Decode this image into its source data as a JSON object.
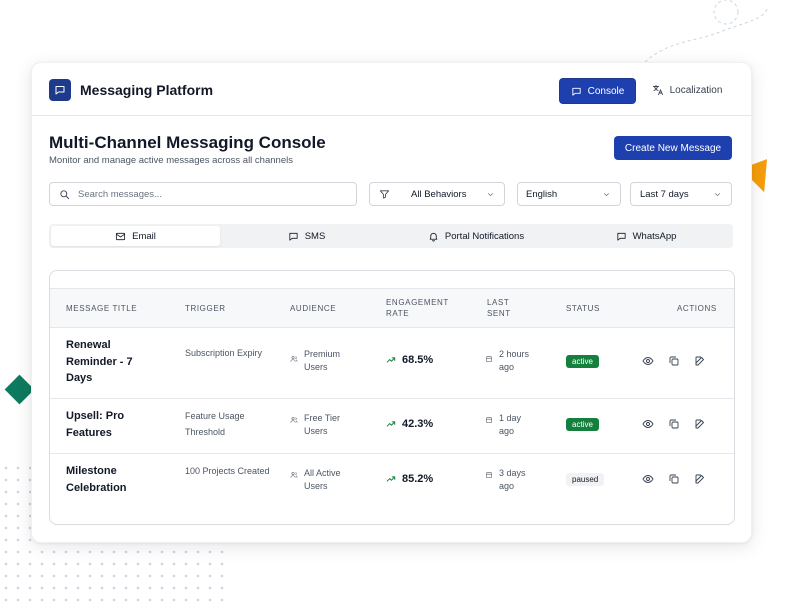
{
  "app": {
    "title": "Messaging Platform"
  },
  "nav": {
    "console_label": "Console",
    "localization_label": "Localization"
  },
  "header": {
    "title": "Multi-Channel Messaging Console",
    "subtitle": "Monitor and manage active messages across all channels",
    "create_label": "Create New Message"
  },
  "filters": {
    "search_placeholder": "Search messages...",
    "behavior_value": "All Behaviors",
    "language_value": "English",
    "range_value": "Last 7 days"
  },
  "tabs": [
    {
      "label": "Email",
      "icon": "mail-icon"
    },
    {
      "label": "SMS",
      "icon": "chat-icon"
    },
    {
      "label": "Portal Notifications",
      "icon": "bell-icon"
    },
    {
      "label": "WhatsApp",
      "icon": "chat-icon"
    }
  ],
  "table": {
    "columns": {
      "title": "Message Title",
      "trigger": "Trigger",
      "audience": "Audience",
      "engagement": "Engagement Rate",
      "last_sent": "Last Sent",
      "status": "Status",
      "actions": "Actions"
    },
    "rows": [
      {
        "title": "Renewal Reminder - 7 Days",
        "trigger": "Subscription Expiry",
        "audience": "Premium Users",
        "engagement": "68.5%",
        "last_sent": "2 hours ago",
        "status": "active"
      },
      {
        "title": "Upsell: Pro Features",
        "trigger": "Feature Usage Threshold",
        "audience": "Free Tier Users",
        "engagement": "42.3%",
        "last_sent": "1 day ago",
        "status": "active"
      },
      {
        "title": "Milestone Celebration",
        "trigger": "100 Projects Created",
        "audience": "All Active Users",
        "engagement": "85.2%",
        "last_sent": "3 days ago",
        "status": "paused"
      }
    ]
  },
  "colors": {
    "primary": "#1e40af",
    "active": "#15803d",
    "accent_orange": "#f59e0b",
    "accent_green": "#0f7a5f"
  }
}
